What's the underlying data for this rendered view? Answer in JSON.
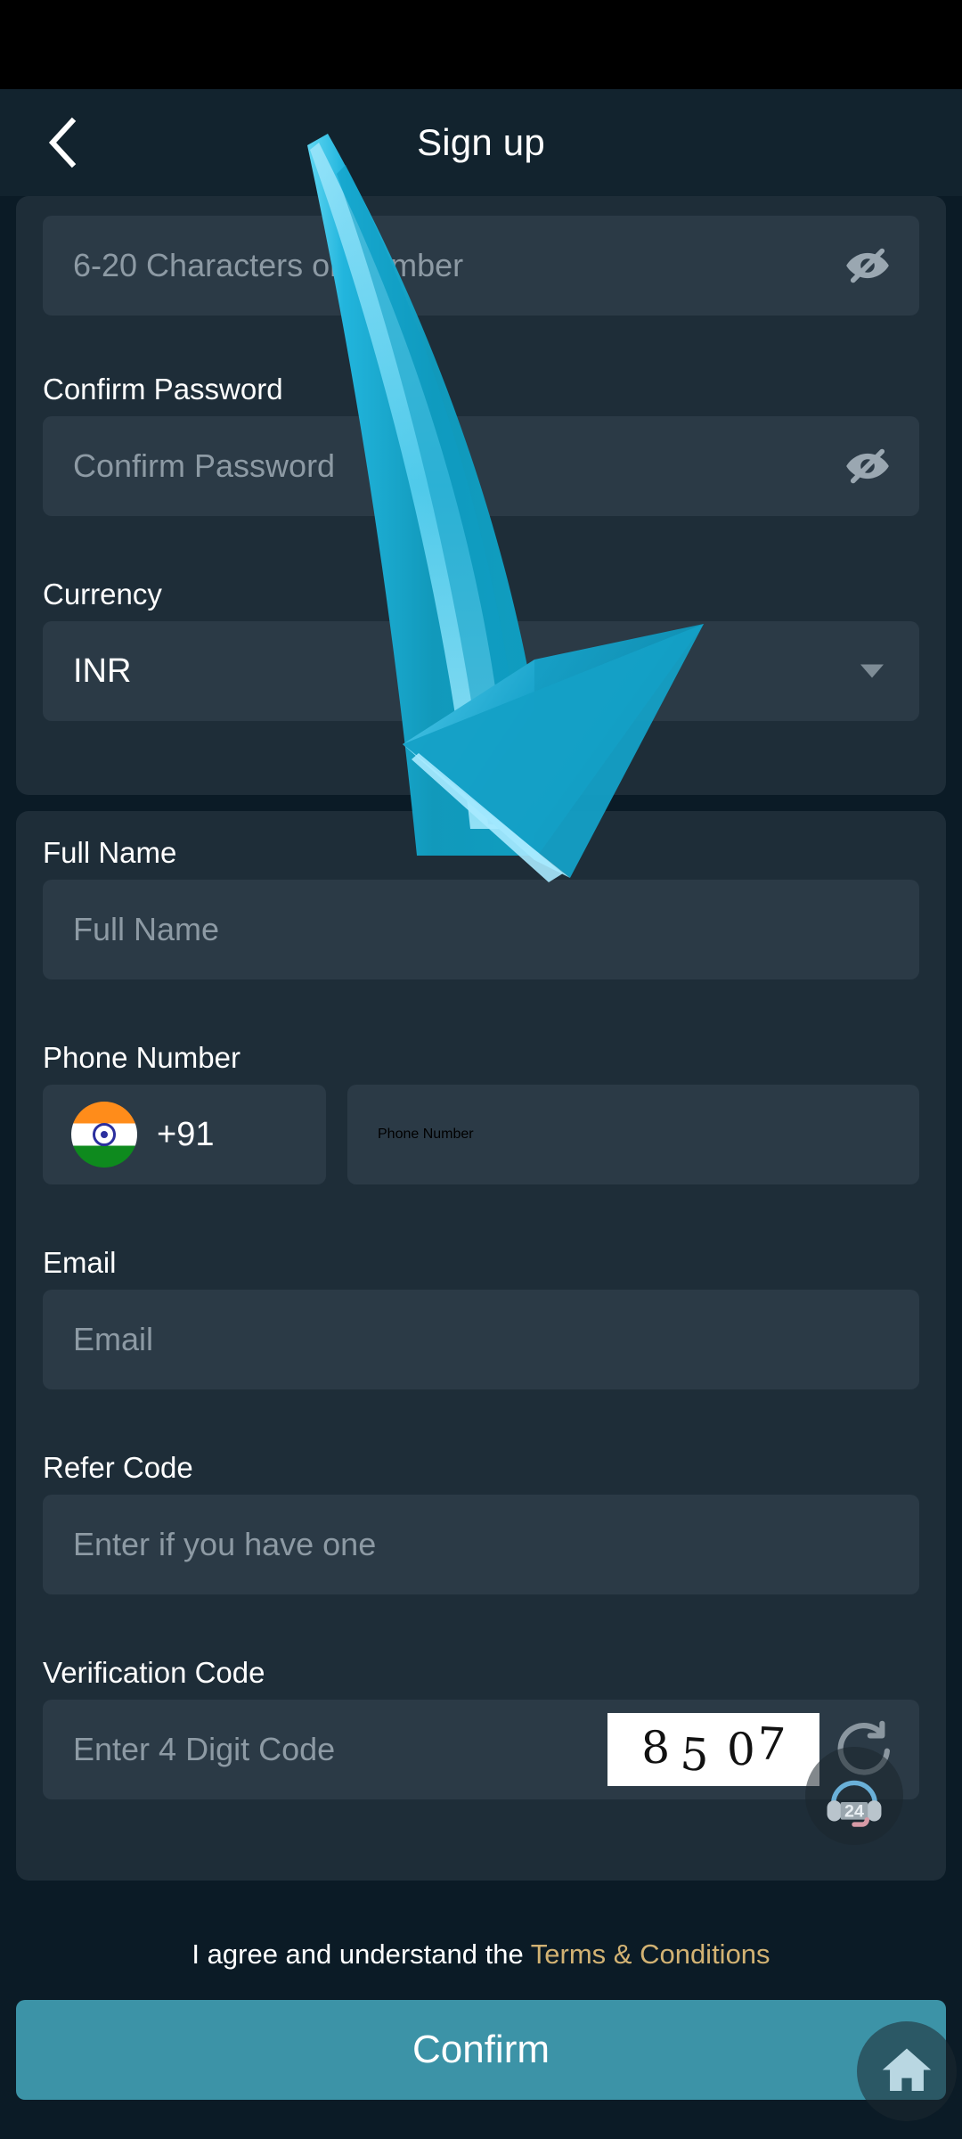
{
  "header": {
    "title": "Sign up",
    "back_icon": "chevron-left-icon"
  },
  "form": {
    "password": {
      "placeholder": "6-20 Characters or Number",
      "value": "",
      "toggle_icon": "eye-off-icon"
    },
    "confirm_password": {
      "label": "Confirm Password",
      "placeholder": "Confirm Password",
      "value": "",
      "toggle_icon": "eye-off-icon"
    },
    "currency": {
      "label": "Currency",
      "value": "INR",
      "dropdown_icon": "chevron-down-icon"
    },
    "full_name": {
      "label": "Full Name",
      "placeholder": "Full Name",
      "value": ""
    },
    "phone": {
      "label": "Phone Number",
      "country_code": "+91",
      "flag_icon": "india-flag-icon",
      "placeholder": "Phone Number",
      "value": ""
    },
    "email": {
      "label": "Email",
      "placeholder": "Email",
      "value": ""
    },
    "refer_code": {
      "label": "Refer Code",
      "placeholder": "Enter if you have one",
      "value": ""
    },
    "verification": {
      "label": "Verification Code",
      "placeholder": "Enter 4 Digit Code",
      "value": "",
      "captcha": {
        "digits": [
          "8",
          "5",
          "0",
          "7"
        ],
        "text": "8507"
      },
      "refresh_icon": "refresh-icon"
    }
  },
  "footer": {
    "agree_text": "I agree and understand the",
    "terms_link": "Terms & Conditions",
    "confirm_label": "Confirm"
  },
  "floating": {
    "support_icon": "headset-24-support-icon",
    "support_badge": "24",
    "home_icon": "home-icon"
  },
  "overlay": {
    "arrow_icon": "curved-down-arrow-icon"
  },
  "colors": {
    "page_background": "#0b1b26",
    "header_background": "#12232e",
    "card_background": "#1e2d38",
    "input_background": "#2b3a46",
    "accent": "#3c93a7",
    "arrow": "#16a2c8",
    "terms_link": "#d2b273",
    "placeholder_text": "#8d9aa4",
    "primary_text": "#ffffff"
  }
}
